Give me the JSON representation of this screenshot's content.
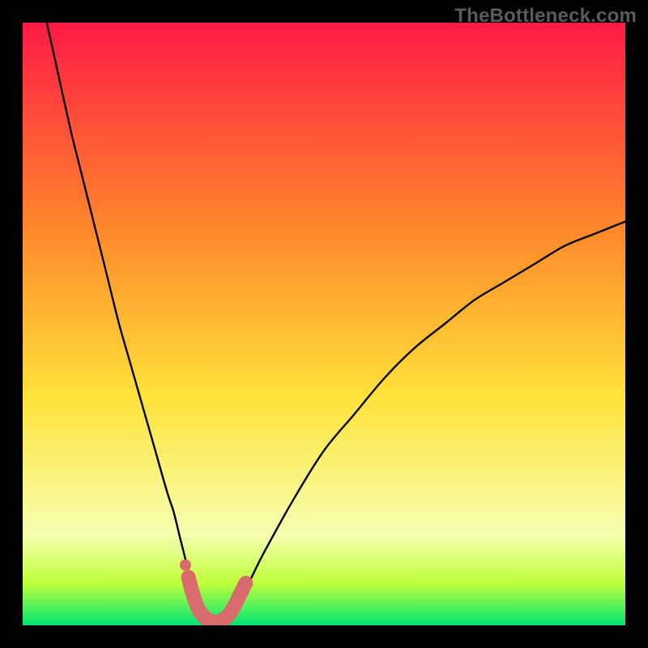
{
  "watermark": {
    "text": "TheBottleneck.com"
  },
  "colors": {
    "page_bg": "#000000",
    "gradient_top": "#ff1a45",
    "gradient_upper_mid": "#ff8a2a",
    "gradient_mid": "#ffe23a",
    "gradient_lower_mid": "#bfff3a",
    "gradient_bottom": "#00e676",
    "curve": "#000000",
    "highlight": "#d86b6b"
  },
  "chart_data": {
    "type": "line",
    "title": "",
    "xlabel": "",
    "ylabel": "",
    "xlim": [
      0,
      100
    ],
    "ylim": [
      0,
      100
    ],
    "grid": false,
    "legend": false,
    "annotations": [
      "TheBottleneck.com"
    ],
    "series": [
      {
        "name": "bottleneck-curve",
        "x": [
          4,
          6,
          8,
          10,
          12,
          14,
          16,
          18,
          20,
          22,
          24,
          25,
          26,
          27,
          28,
          29,
          30,
          31,
          32,
          33,
          34,
          35,
          36,
          38,
          40,
          45,
          50,
          55,
          60,
          65,
          70,
          75,
          80,
          85,
          90,
          95,
          100
        ],
        "y": [
          100,
          91,
          82,
          74,
          66,
          58,
          50,
          43,
          36,
          29,
          22,
          19,
          15,
          11,
          7,
          4,
          2,
          1,
          0.5,
          0.5,
          1,
          2,
          4,
          8,
          12,
          21,
          29,
          35,
          41,
          46,
          50,
          54,
          57,
          60,
          63,
          65,
          67
        ]
      },
      {
        "name": "highlight-segment",
        "x": [
          27.5,
          28,
          29,
          30,
          31,
          32,
          33,
          34,
          35,
          36,
          37
        ],
        "y": [
          8,
          6,
          3,
          1.5,
          0.8,
          0.5,
          0.8,
          1.5,
          3,
          5,
          7
        ]
      },
      {
        "name": "highlight-dot",
        "x": [
          27
        ],
        "y": [
          10
        ]
      }
    ]
  }
}
